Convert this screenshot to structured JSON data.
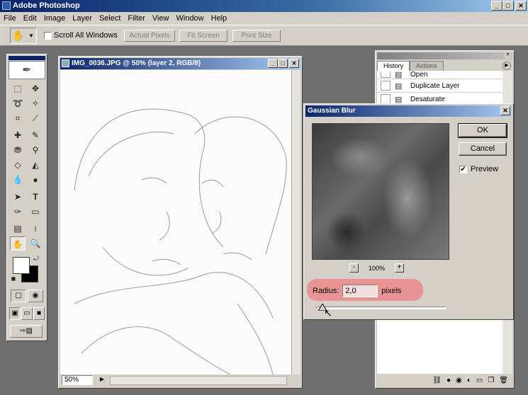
{
  "app": {
    "title": "Adobe Photoshop"
  },
  "window_buttons": {
    "minimize": "_",
    "maximize": "□",
    "close": "✕"
  },
  "menu": [
    "File",
    "Edit",
    "Image",
    "Layer",
    "Select",
    "Filter",
    "View",
    "Window",
    "Help"
  ],
  "options": {
    "tool_icon": "hand-icon",
    "tool_glyph": "✋",
    "dropdown_glyph": "▼",
    "scroll_all_windows": "Scroll All Windows",
    "scroll_all_checked": false,
    "actual_pixels": "Actual Pixels",
    "fit_screen": "Fit Screen",
    "print_size": "Print Size"
  },
  "document": {
    "title": "IMG_0036.JPG @ 50% (layer 2, RGB/8)",
    "zoom": "50%"
  },
  "history_panel": {
    "tabs": [
      "History",
      "Actions"
    ],
    "active_tab": "History",
    "items": [
      {
        "label": "Open"
      },
      {
        "label": "Duplicate Layer"
      },
      {
        "label": "Desaturate"
      }
    ]
  },
  "gaussian_blur": {
    "title": "Gaussian Blur",
    "ok": "OK",
    "cancel": "Cancel",
    "preview_label": "Preview",
    "preview_checked": true,
    "zoom_minus": "-",
    "zoom_plus": "+",
    "zoom_level": "100%",
    "radius_label": "Radius:",
    "radius_value": "2,0",
    "radius_unit": "pixels",
    "slider_value_fraction": 0.05
  },
  "colors": {
    "title_bar": "#0a246a",
    "chrome": "#d4d0c8",
    "workspace": "#6f6f6f",
    "radius_highlight": "#e89494"
  }
}
